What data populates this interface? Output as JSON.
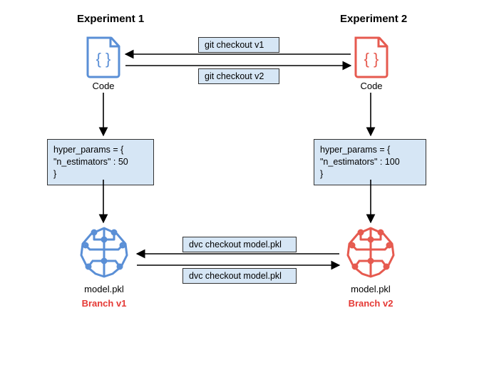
{
  "experiment1": {
    "title": "Experiment 1",
    "code_label": "Code",
    "params_line1": "hyper_params = {",
    "params_line2": "\"n_estimators\" : 50",
    "params_line3": "}",
    "model_label": "model.pkl",
    "branch_label": "Branch v1"
  },
  "experiment2": {
    "title": "Experiment 2",
    "code_label": "Code",
    "params_line1": "hyper_params = {",
    "params_line2": "\"n_estimators\" : 100",
    "params_line3": "}",
    "model_label": "model.pkl",
    "branch_label": "Branch v2"
  },
  "commands": {
    "git_v1": "git checkout v1",
    "git_v2": "git checkout v2",
    "dvc_top": "dvc checkout model.pkl",
    "dvc_bot": "dvc checkout model.pkl"
  },
  "colors": {
    "blue": "#5a8fd6",
    "red": "#e65a4f",
    "box_bg": "#d6e6f5",
    "branch_text": "#e53935"
  }
}
